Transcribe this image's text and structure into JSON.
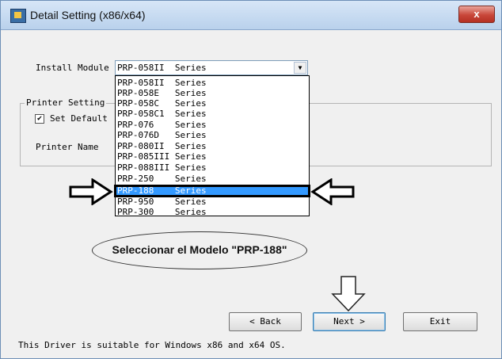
{
  "window": {
    "title": "Detail Setting (x86/x64)",
    "close_label": "x"
  },
  "install_module": {
    "label": "Install Module",
    "selected_value": "PRP-058II  Series",
    "options": [
      "PRP-058II  Series",
      "PRP-058E   Series",
      "PRP-058C   Series",
      "PRP-058C1  Series",
      "PRP-076    Series",
      "PRP-076D   Series",
      "PRP-080II  Series",
      "PRP-085III Series",
      "PRP-088III Series",
      "PRP-250    Series",
      "PRP-188    Series",
      "PRP-950    Series",
      "PRP-300    Series"
    ],
    "highlighted_option": "PRP-188    Series"
  },
  "printer_setting": {
    "group_label": "Printer Setting",
    "set_default_label": "Set Default",
    "set_default_checked": true,
    "printer_name_label": "Printer Name"
  },
  "annotation": {
    "text": "Seleccionar el Modelo \"PRP-188\""
  },
  "buttons": {
    "back": "< Back",
    "next": "Next >",
    "exit": "Exit"
  },
  "footer": {
    "text": "This Driver is suitable for Windows x86 and x64 OS."
  },
  "colors": {
    "selection": "#3399ff",
    "title_gradient_top": "#d7e6f7",
    "close_button": "#c8473a"
  }
}
